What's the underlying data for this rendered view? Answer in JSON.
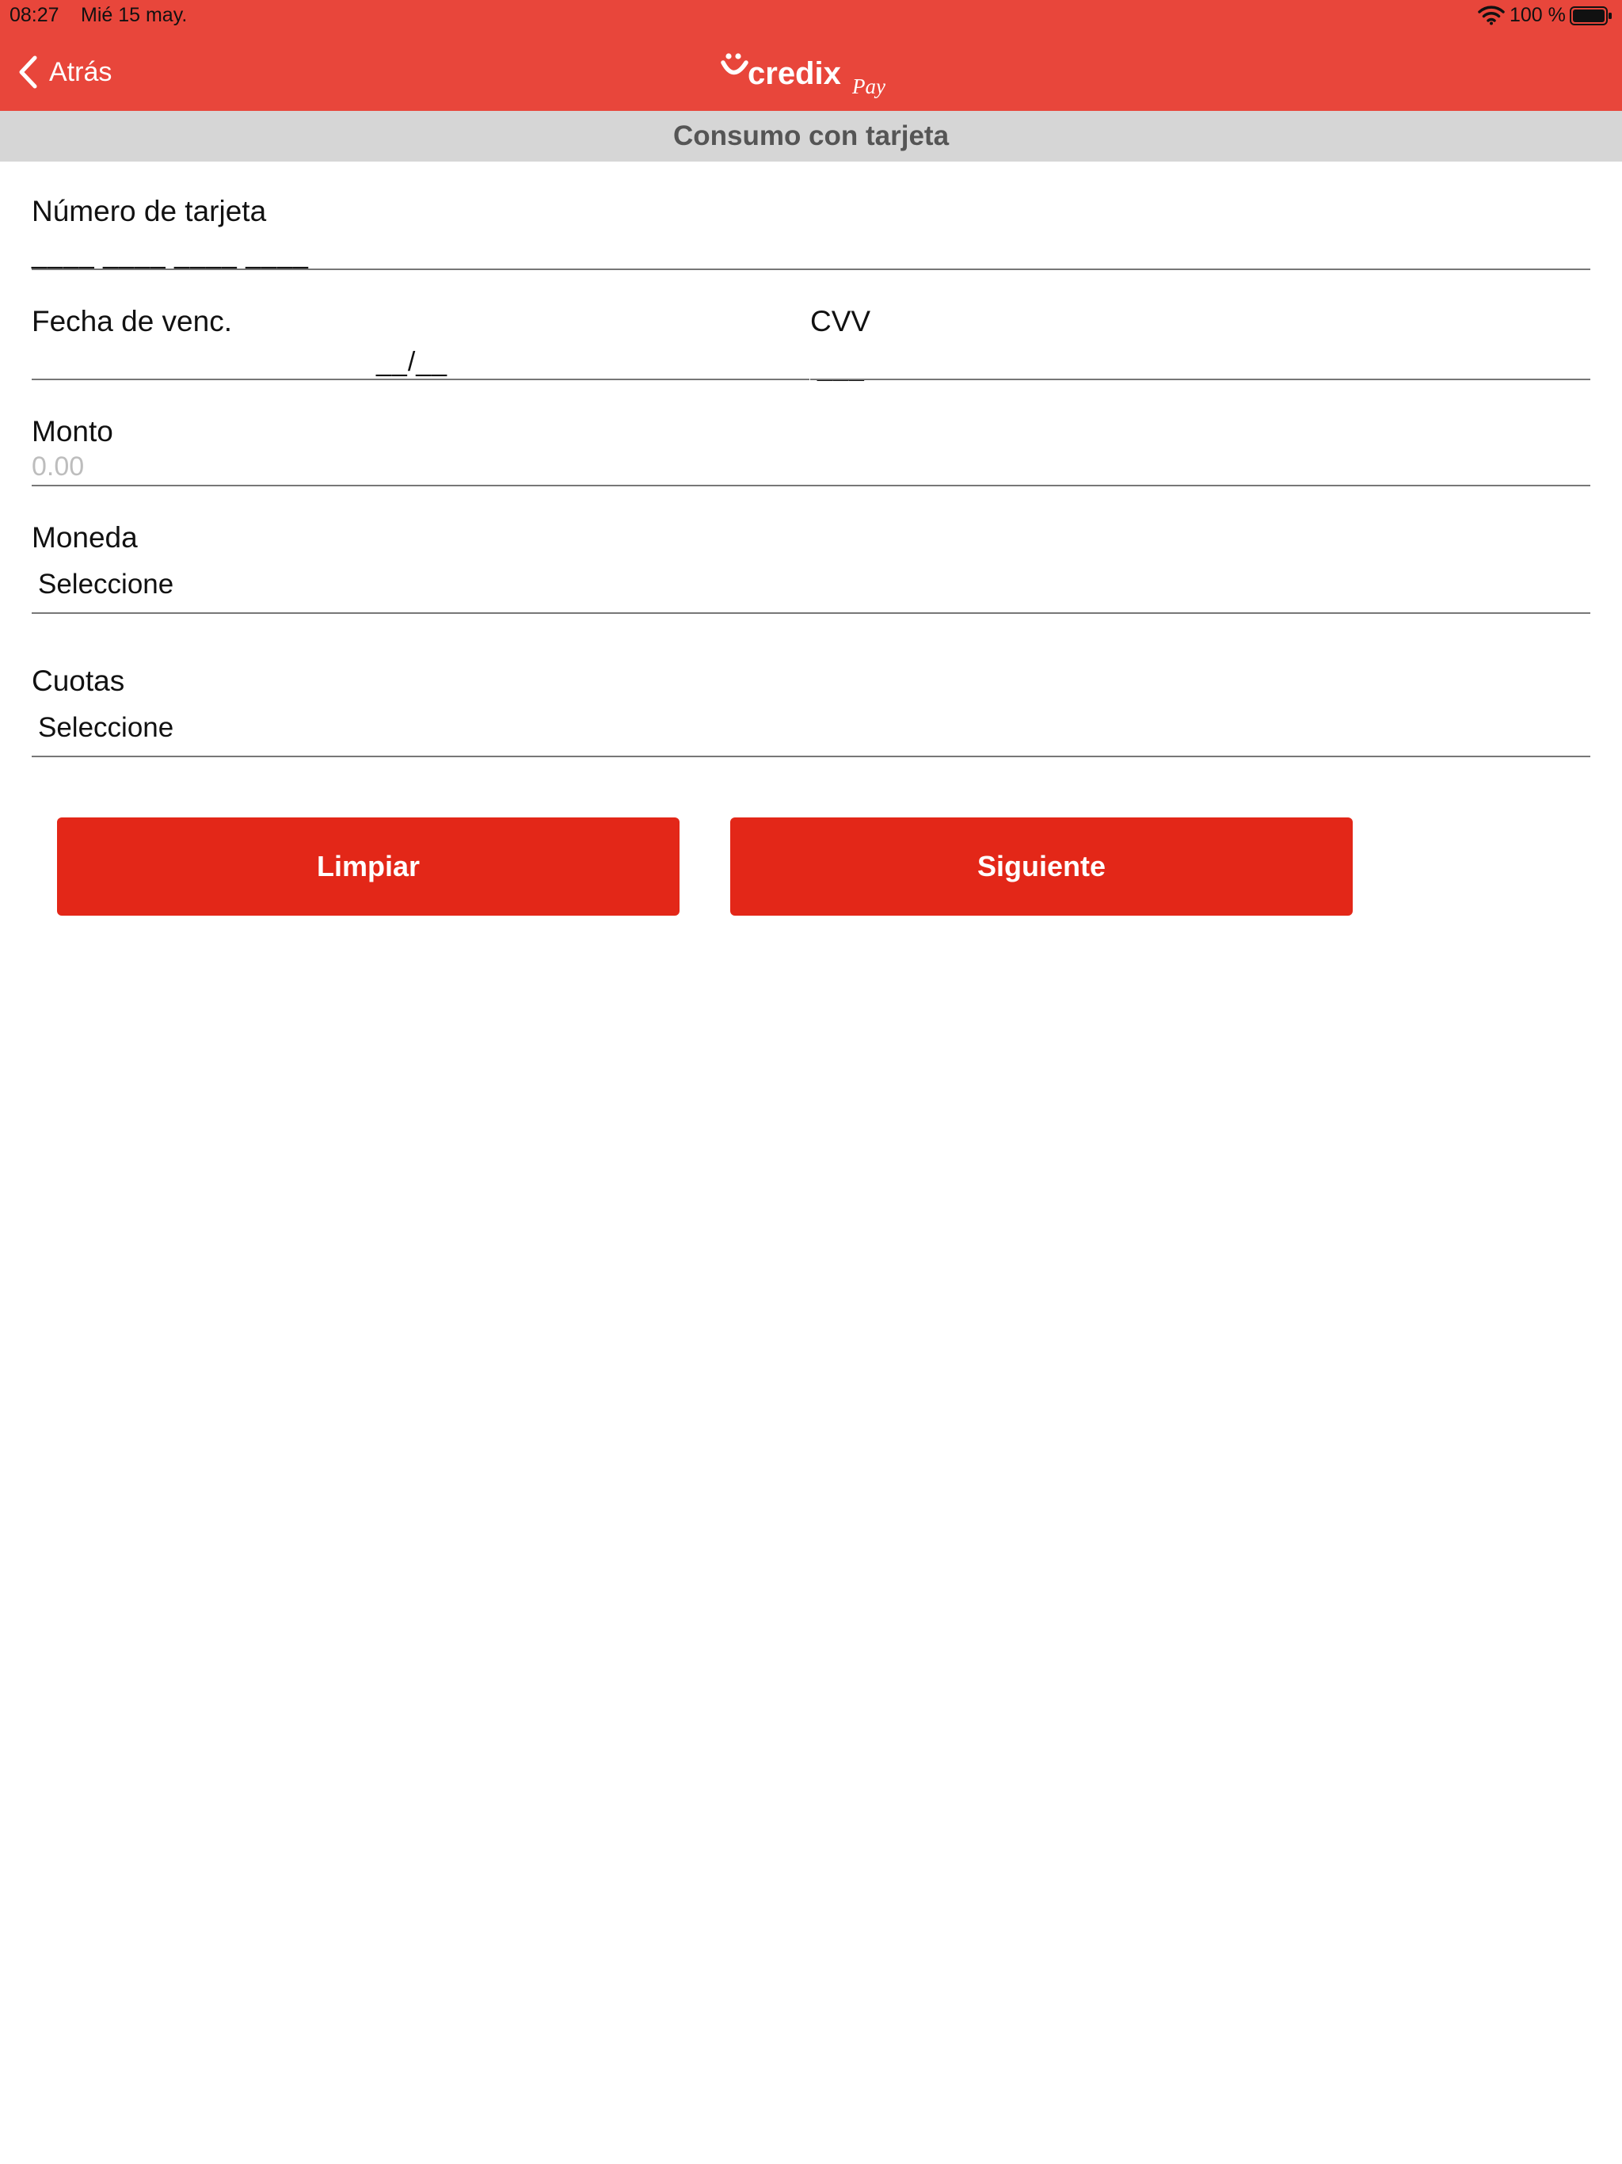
{
  "status_bar": {
    "time": "08:27",
    "date": "Mié 15 may.",
    "battery": "100 %"
  },
  "nav": {
    "back_label": "Atrás",
    "logo_main": "credix",
    "logo_sub": "Pay"
  },
  "section": {
    "title": "Consumo con tarjeta"
  },
  "form": {
    "card_number": {
      "label": "Número de tarjeta",
      "mask": "____ ____ ____ ____"
    },
    "expiry": {
      "label": "Fecha de venc.",
      "mask": "__/__"
    },
    "cvv": {
      "label": "CVV",
      "mask": "___"
    },
    "amount": {
      "label": "Monto",
      "placeholder": "0.00"
    },
    "currency": {
      "label": "Moneda",
      "value": "Seleccione"
    },
    "installments": {
      "label": "Cuotas",
      "value": "Seleccione"
    }
  },
  "buttons": {
    "clear": "Limpiar",
    "next": "Siguiente"
  },
  "colors": {
    "header": "#e8463b",
    "button": "#e32718",
    "section_bar": "#d6d6d6",
    "section_text": "#555555"
  }
}
